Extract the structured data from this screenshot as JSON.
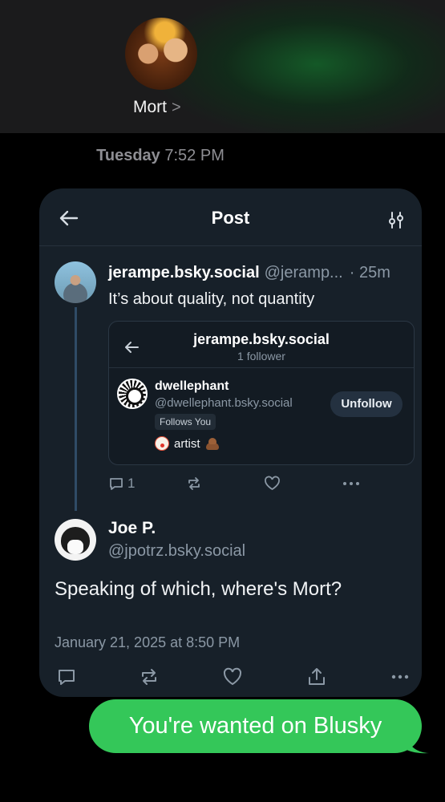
{
  "conversation": {
    "contact_name": "Mort",
    "chevron": ">",
    "timestamp_day": "Tuesday",
    "timestamp_time": "7:52 PM",
    "outgoing_message": "You're wanted on Blusky"
  },
  "card": {
    "title": "Post",
    "parent_post": {
      "display_name": "jerampe.bsky.social",
      "handle": "@jeramp...",
      "age": "· 25m",
      "text": "It’s about quality, not quantity",
      "reply_count": "1",
      "embed": {
        "title": "jerampe.bsky.social",
        "subtitle": "1 follower",
        "user_display_name": "dwellephant",
        "user_handle": "@dwellephant.bsky.social",
        "badge": "Follows You",
        "bio_word": "artist",
        "unfollow_label": "Unfollow"
      }
    },
    "main_post": {
      "display_name": "Joe P.",
      "handle": "@jpotrz.bsky.social",
      "text": "Speaking of which, where's Mort?",
      "date": "January 21, 2025 at 8:50 PM"
    }
  },
  "colors": {
    "card_bg": "#172029",
    "accent_green": "#34c759",
    "muted_text": "#8b98a5"
  },
  "icons": [
    "back-arrow-icon",
    "sliders-icon",
    "reply-icon",
    "repost-icon",
    "like-icon",
    "more-icon",
    "share-icon",
    "clown-emoji-icon",
    "poo-emoji-icon"
  ]
}
